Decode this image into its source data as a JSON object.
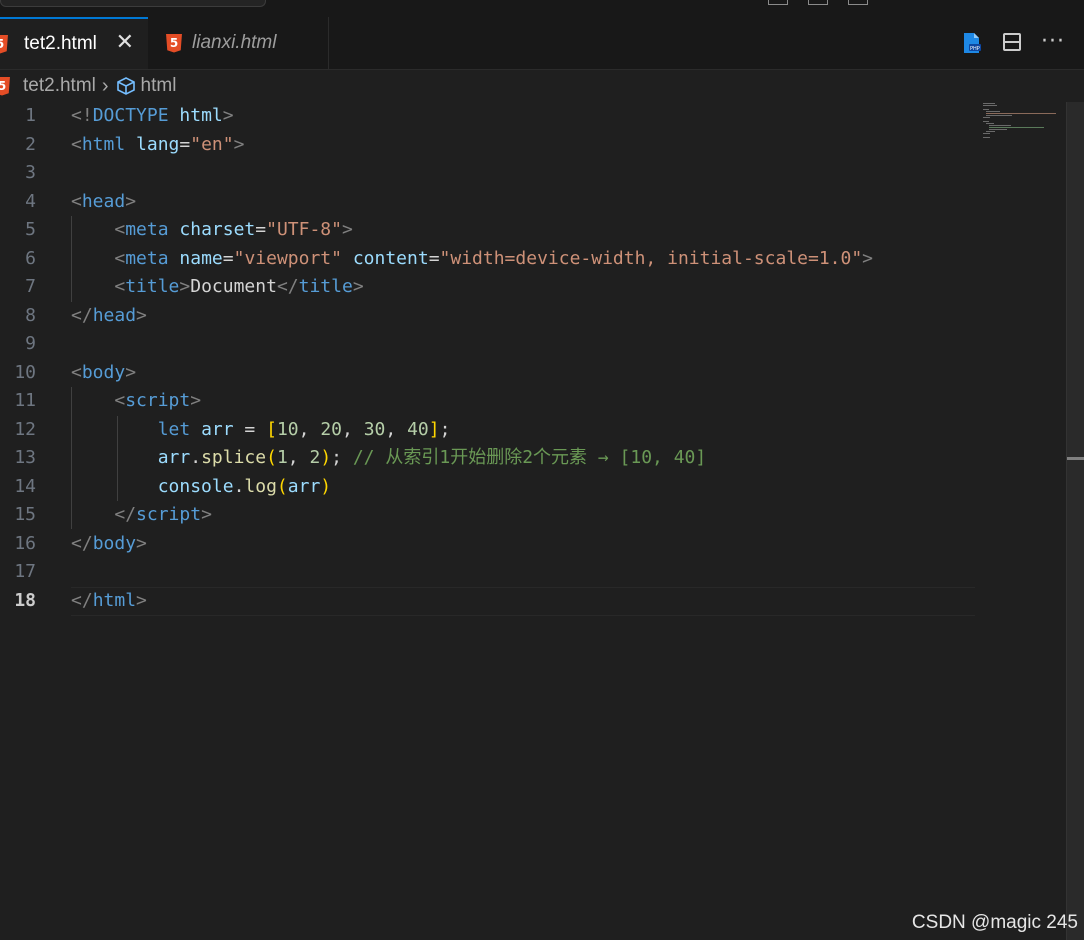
{
  "tabs": [
    {
      "label": "tet2.html",
      "active": true,
      "close_glyph": "✕",
      "icon": "html5-icon"
    },
    {
      "label": "lianxi.html",
      "active": false,
      "icon": "html5-icon"
    }
  ],
  "toolbar": {
    "php_icon": "php-file-icon",
    "split_icon": "split-editor-icon",
    "more_glyph": "···"
  },
  "breadcrumb": {
    "file": "tet2.html",
    "separator": "›",
    "symbol": "html"
  },
  "editor": {
    "current_line": 18,
    "lines": [
      {
        "n": "1",
        "tokens": [
          [
            "c-p",
            "<!"
          ],
          [
            "c-t",
            "DOCTYPE"
          ],
          [
            "c-w",
            " "
          ],
          [
            "c-a",
            "html"
          ],
          [
            "c-p",
            ">"
          ]
        ]
      },
      {
        "n": "2",
        "tokens": [
          [
            "c-p",
            "<"
          ],
          [
            "c-t",
            "html"
          ],
          [
            "c-w",
            " "
          ],
          [
            "c-a",
            "lang"
          ],
          [
            "c-w",
            "="
          ],
          [
            "c-s",
            "\"en\""
          ],
          [
            "c-p",
            ">"
          ]
        ]
      },
      {
        "n": "3",
        "tokens": []
      },
      {
        "n": "4",
        "tokens": [
          [
            "c-p",
            "<"
          ],
          [
            "c-t",
            "head"
          ],
          [
            "c-p",
            ">"
          ]
        ]
      },
      {
        "n": "5",
        "tokens": [
          [
            "c-w",
            "    "
          ],
          [
            "c-p",
            "<"
          ],
          [
            "c-t",
            "meta"
          ],
          [
            "c-w",
            " "
          ],
          [
            "c-a",
            "charset"
          ],
          [
            "c-w",
            "="
          ],
          [
            "c-s",
            "\"UTF-8\""
          ],
          [
            "c-p",
            ">"
          ]
        ]
      },
      {
        "n": "6",
        "tokens": [
          [
            "c-w",
            "    "
          ],
          [
            "c-p",
            "<"
          ],
          [
            "c-t",
            "meta"
          ],
          [
            "c-w",
            " "
          ],
          [
            "c-a",
            "name"
          ],
          [
            "c-w",
            "="
          ],
          [
            "c-s",
            "\"viewport\""
          ],
          [
            "c-w",
            " "
          ],
          [
            "c-a",
            "content"
          ],
          [
            "c-w",
            "="
          ],
          [
            "c-s",
            "\"width=device-width, initial-scale=1.0\""
          ],
          [
            "c-p",
            ">"
          ]
        ]
      },
      {
        "n": "7",
        "tokens": [
          [
            "c-w",
            "    "
          ],
          [
            "c-p",
            "<"
          ],
          [
            "c-t",
            "title"
          ],
          [
            "c-p",
            ">"
          ],
          [
            "c-w",
            "Document"
          ],
          [
            "c-p",
            "</"
          ],
          [
            "c-t",
            "title"
          ],
          [
            "c-p",
            ">"
          ]
        ]
      },
      {
        "n": "8",
        "tokens": [
          [
            "c-p",
            "</"
          ],
          [
            "c-t",
            "head"
          ],
          [
            "c-p",
            ">"
          ]
        ]
      },
      {
        "n": "9",
        "tokens": []
      },
      {
        "n": "10",
        "tokens": [
          [
            "c-p",
            "<"
          ],
          [
            "c-t",
            "body"
          ],
          [
            "c-p",
            ">"
          ]
        ]
      },
      {
        "n": "11",
        "tokens": [
          [
            "c-w",
            "    "
          ],
          [
            "c-p",
            "<"
          ],
          [
            "c-t",
            "script"
          ],
          [
            "c-p",
            ">"
          ]
        ]
      },
      {
        "n": "12",
        "tokens": [
          [
            "c-w",
            "        "
          ],
          [
            "c-k",
            "let"
          ],
          [
            "c-w",
            " "
          ],
          [
            "c-v",
            "arr"
          ],
          [
            "c-w",
            " = "
          ],
          [
            "c-b",
            "["
          ],
          [
            "c-n",
            "10"
          ],
          [
            "c-w",
            ", "
          ],
          [
            "c-n",
            "20"
          ],
          [
            "c-w",
            ", "
          ],
          [
            "c-n",
            "30"
          ],
          [
            "c-w",
            ", "
          ],
          [
            "c-n",
            "40"
          ],
          [
            "c-b",
            "]"
          ],
          [
            "c-w",
            ";"
          ]
        ]
      },
      {
        "n": "13",
        "tokens": [
          [
            "c-w",
            "        "
          ],
          [
            "c-v",
            "arr"
          ],
          [
            "c-w",
            "."
          ],
          [
            "c-f",
            "splice"
          ],
          [
            "c-b",
            "("
          ],
          [
            "c-n",
            "1"
          ],
          [
            "c-w",
            ", "
          ],
          [
            "c-n",
            "2"
          ],
          [
            "c-b",
            ")"
          ],
          [
            "c-w",
            "; "
          ],
          [
            "c-c",
            "// 从索引1开始删除2个元素 → [10, 40]"
          ]
        ]
      },
      {
        "n": "14",
        "tokens": [
          [
            "c-w",
            "        "
          ],
          [
            "c-v",
            "console"
          ],
          [
            "c-w",
            "."
          ],
          [
            "c-f",
            "log"
          ],
          [
            "c-b",
            "("
          ],
          [
            "c-v",
            "arr"
          ],
          [
            "c-b",
            ")"
          ]
        ]
      },
      {
        "n": "15",
        "tokens": [
          [
            "c-w",
            "    "
          ],
          [
            "c-p",
            "</"
          ],
          [
            "c-t",
            "script"
          ],
          [
            "c-p",
            ">"
          ]
        ]
      },
      {
        "n": "16",
        "tokens": [
          [
            "c-p",
            "</"
          ],
          [
            "c-t",
            "body"
          ],
          [
            "c-p",
            ">"
          ]
        ]
      },
      {
        "n": "17",
        "tokens": []
      },
      {
        "n": "18",
        "tokens": [
          [
            "c-p",
            "</"
          ],
          [
            "c-t",
            "html"
          ],
          [
            "c-p",
            ">"
          ]
        ]
      }
    ]
  },
  "watermark": "CSDN @magic 245"
}
